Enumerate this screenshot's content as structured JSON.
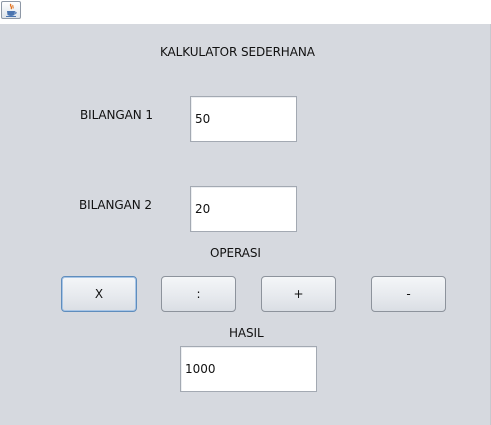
{
  "window": {
    "icon": "java-cup-icon"
  },
  "app": {
    "title": "KALKULATOR SEDERHANA"
  },
  "inputs": {
    "bilangan1": {
      "label": "BILANGAN 1",
      "value": "50"
    },
    "bilangan2": {
      "label": "BILANGAN 2",
      "value": "20"
    }
  },
  "operasi": {
    "label": "OPERASI",
    "buttons": {
      "multiply": "X",
      "divide": ":",
      "add": "+",
      "subtract": "-"
    }
  },
  "hasil": {
    "label": "HASIL",
    "value": "1000"
  }
}
